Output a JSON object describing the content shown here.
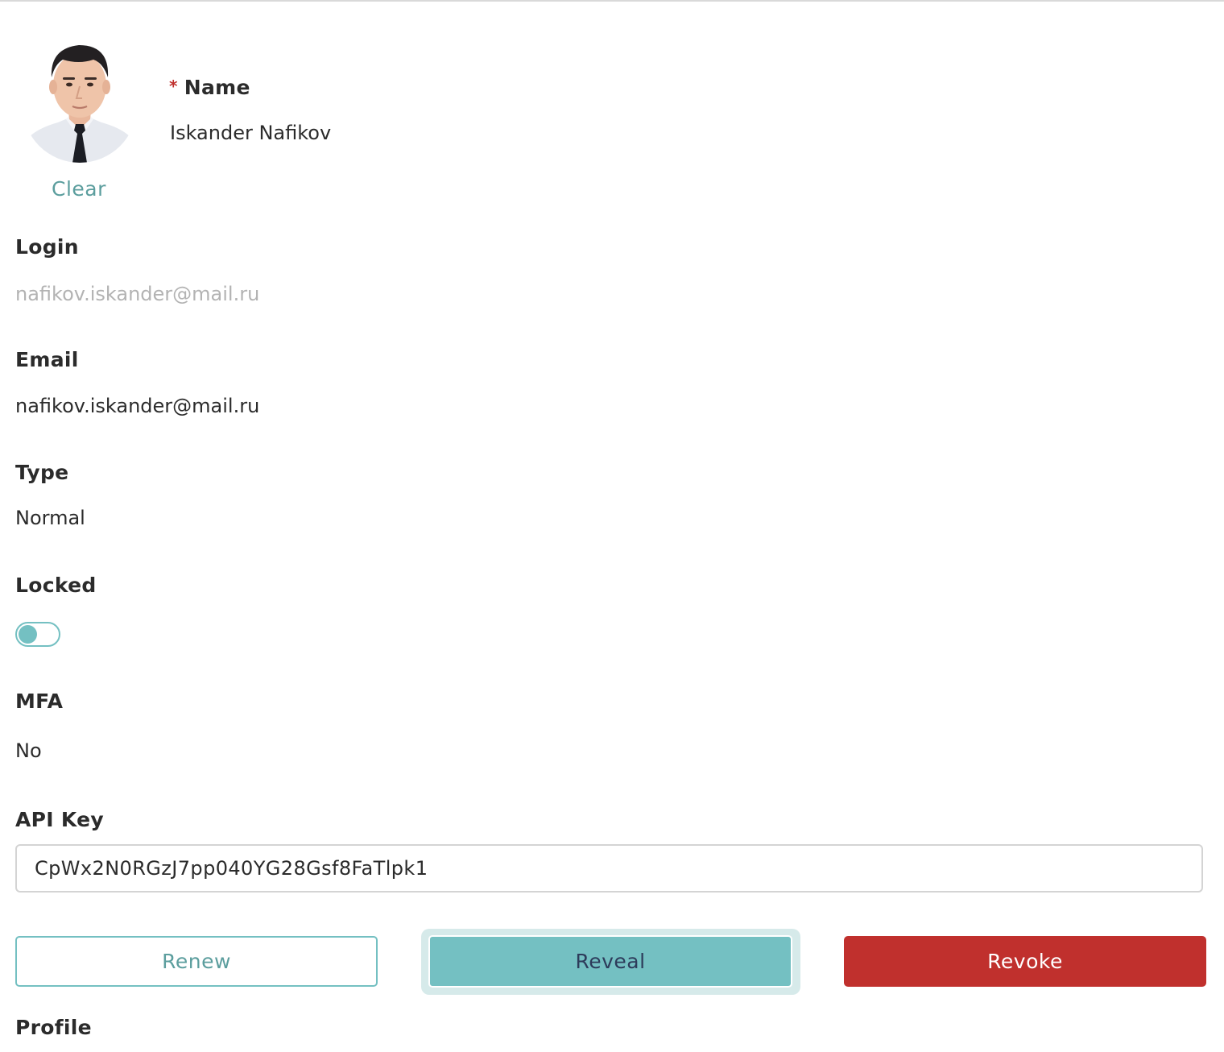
{
  "avatar": {
    "action_label": "Clear"
  },
  "name": {
    "required_marker": "*",
    "label": "Name",
    "value": "Iskander Nafikov"
  },
  "login": {
    "label": "Login",
    "value": "nafikov.iskander@mail.ru"
  },
  "email": {
    "label": "Email",
    "value": "nafikov.iskander@mail.ru"
  },
  "type": {
    "label": "Type",
    "value": "Normal"
  },
  "locked": {
    "label": "Locked",
    "enabled": false
  },
  "mfa": {
    "label": "MFA",
    "value": "No"
  },
  "api_key": {
    "label": "API Key",
    "value": "CpWx2N0RGzJ7pp040YG28Gsf8FaTlpk1"
  },
  "actions": {
    "renew_label": "Renew",
    "reveal_label": "Reveal",
    "revoke_label": "Revoke"
  },
  "profile": {
    "label": "Profile"
  },
  "colors": {
    "accent": "#74c0c2",
    "accent_text": "#5c9e9e",
    "danger": "#c0302d",
    "required": "#c0302d"
  }
}
